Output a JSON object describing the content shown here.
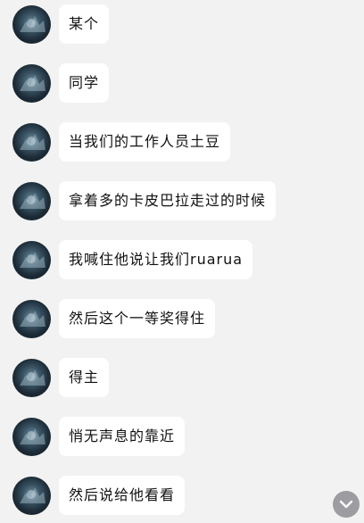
{
  "messages": [
    {
      "text": "某个"
    },
    {
      "text": "同学"
    },
    {
      "text": "当我们的工作人员土豆"
    },
    {
      "text": "拿着多的卡皮巴拉走过的时候"
    },
    {
      "text": "我喊住他说让我们ruarua"
    },
    {
      "text": "然后这个一等奖得住"
    },
    {
      "text": "得主"
    },
    {
      "text": "悄无声息的靠近"
    },
    {
      "text": "然后说给他看看"
    }
  ],
  "icons": {
    "avatar": "avatar-image",
    "scroll_down": "chevron-down-icon"
  },
  "colors": {
    "background": "#f2f2f2",
    "bubble": "#ffffff",
    "text": "#111111",
    "scroll_button": "#8e8e93"
  }
}
